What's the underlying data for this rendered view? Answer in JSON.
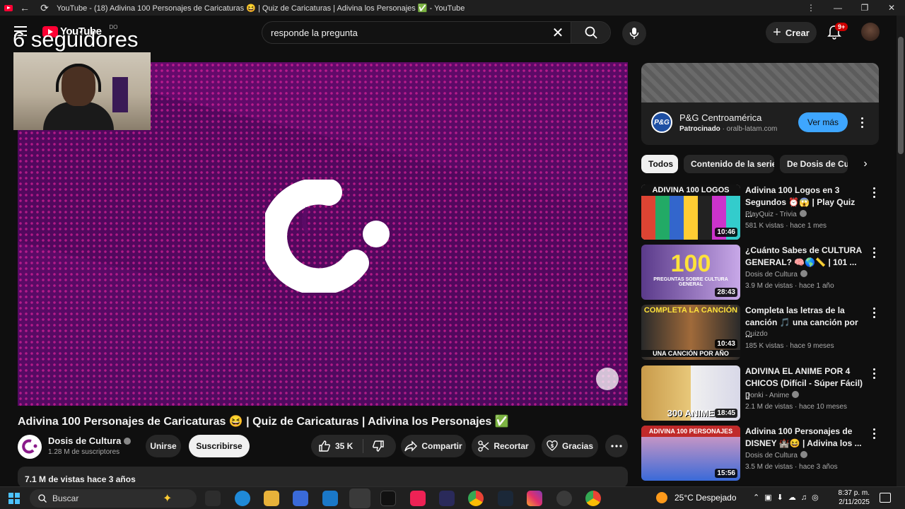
{
  "browser": {
    "tab_title": "YouTube - (18) Adivina 100 Personajes de Caricaturas 😆 | Quiz de Caricaturas | Adivina los Personajes ✅ - YouTube",
    "back": "←",
    "reload": "⟳",
    "menu": "⋮",
    "minimize": "—",
    "maximize": "❐",
    "close": "✕"
  },
  "header": {
    "logo_text": "YouTube",
    "country_code": "DO",
    "search_value": "responde la pregunta",
    "clear": "✕",
    "create_label": "Crear",
    "notif_badge": "9+"
  },
  "overlay": {
    "followers": "6 seguidores"
  },
  "video": {
    "title": "Adivina 100 Personajes de Caricaturas 😆 | Quiz de Caricaturas | Adivina los Personajes ✅",
    "channel_name": "Dosis de Cultura",
    "subscribers": "1.28 M de suscriptores",
    "join_label": "Unirse",
    "subscribe_label": "Suscribirse",
    "likes": "35 K",
    "share_label": "Compartir",
    "clip_label": "Recortar",
    "thanks_label": "Gracias",
    "views_date": "7.1 M de vistas  hace 3 años"
  },
  "ad": {
    "logo_text": "P&G",
    "advertiser": "P&G Centroamérica",
    "sponsored": "Patrocinado",
    "domain": " · oralb-latam.com",
    "cta": "Ver más"
  },
  "chips": [
    "Todos",
    "Contenido de la serie",
    "De Dosis de Cultura"
  ],
  "recommendations": [
    {
      "title": "Adivina 100 Logos en 3 Segundos ⏰😱 | Play Quiz ...",
      "channel": "PlayQuiz - Trivia",
      "meta": "581 K vistas · hace 1 mes",
      "duration": "10:46",
      "thumb_text": "ADIVINA 100 LOGOS",
      "colors": [
        "#1c1c1c",
        "#e8e8e8"
      ]
    },
    {
      "title": "¿Cuánto Sabes de CULTURA GENERAL? 🧠🌎📏 | 101 ...",
      "channel": "Dosis de Cultura",
      "meta": "3.9 M de vistas · hace 1 año",
      "duration": "28:43",
      "thumb_text": "100",
      "thumb_sub": "PREGUNTAS SOBRE CULTURA GENERAL",
      "colors": [
        "#6a3fa0",
        "#b89bd8"
      ]
    },
    {
      "title": "Completa las letras de la canción 🎵 una canción por ...",
      "channel": "Quizdo",
      "meta": "185 K vistas · hace 9 meses",
      "duration": "10:43",
      "thumb_text": "COMPLETA LA CANCIÓN",
      "thumb_sub": "UNA CANCIÓN POR AÑO",
      "colors": [
        "#2a2a2a",
        "#8a4a2a"
      ]
    },
    {
      "title": "ADIVINA EL ANIME POR 4 CHICOS (Difícil - Súper Fácil) ▯",
      "channel": "Donki - Anime",
      "meta": "2.1 M de vistas · hace 10 meses",
      "duration": "18:45",
      "thumb_text": "300 ANIME",
      "colors": [
        "#3a2a1a",
        "#d8c8b8"
      ]
    },
    {
      "title": "Adivina 100 Personajes de DISNEY 🏰😆 | Adivina los ...",
      "channel": "Dosis de Cultura",
      "meta": "3.5 M de vistas · hace 3 años",
      "duration": "15:56",
      "thumb_text": "ADIVINA 100 PERSONAJES",
      "colors": [
        "#3a6ad8",
        "#f0c0d0"
      ]
    }
  ],
  "taskbar": {
    "search_placeholder": "Buscar",
    "weather": "25°C  Despejado",
    "time": "8:37 p. m.",
    "date": "2/11/2025"
  }
}
